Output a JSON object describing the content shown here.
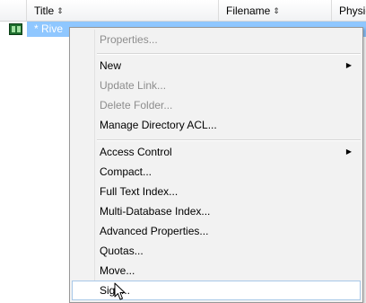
{
  "header": {
    "columns": [
      {
        "label": ""
      },
      {
        "label": "Title",
        "sort_icon": "sort-updown-icon"
      },
      {
        "label": "Filename",
        "sort_icon": "sort-updown-icon"
      },
      {
        "label": "Physic"
      }
    ],
    "sort_glyph": "⇕"
  },
  "row": {
    "icon": "database-icon",
    "title": "* Rive"
  },
  "context_menu": {
    "items": [
      {
        "label": "Properties...",
        "enabled": false
      },
      {
        "label": "New",
        "enabled": true,
        "submenu": true
      },
      {
        "label": "Update Link...",
        "enabled": false
      },
      {
        "label": "Delete Folder...",
        "enabled": false
      },
      {
        "label": "Manage Directory ACL...",
        "enabled": true
      },
      {
        "label": "Access Control",
        "enabled": true,
        "submenu": true
      },
      {
        "label": "Compact...",
        "enabled": true
      },
      {
        "label": "Full Text Index...",
        "enabled": true
      },
      {
        "label": "Multi-Database Index...",
        "enabled": true
      },
      {
        "label": "Advanced Properties...",
        "enabled": true
      },
      {
        "label": "Quotas...",
        "enabled": true
      },
      {
        "label": "Move...",
        "enabled": true
      },
      {
        "label": "Sign...",
        "enabled": true,
        "hovered": true
      }
    ],
    "submenu_glyph": "▶"
  },
  "colors": {
    "selection": "#3399ff",
    "menu_background": "#f2f2f2",
    "disabled_text": "#8d8d8d"
  }
}
